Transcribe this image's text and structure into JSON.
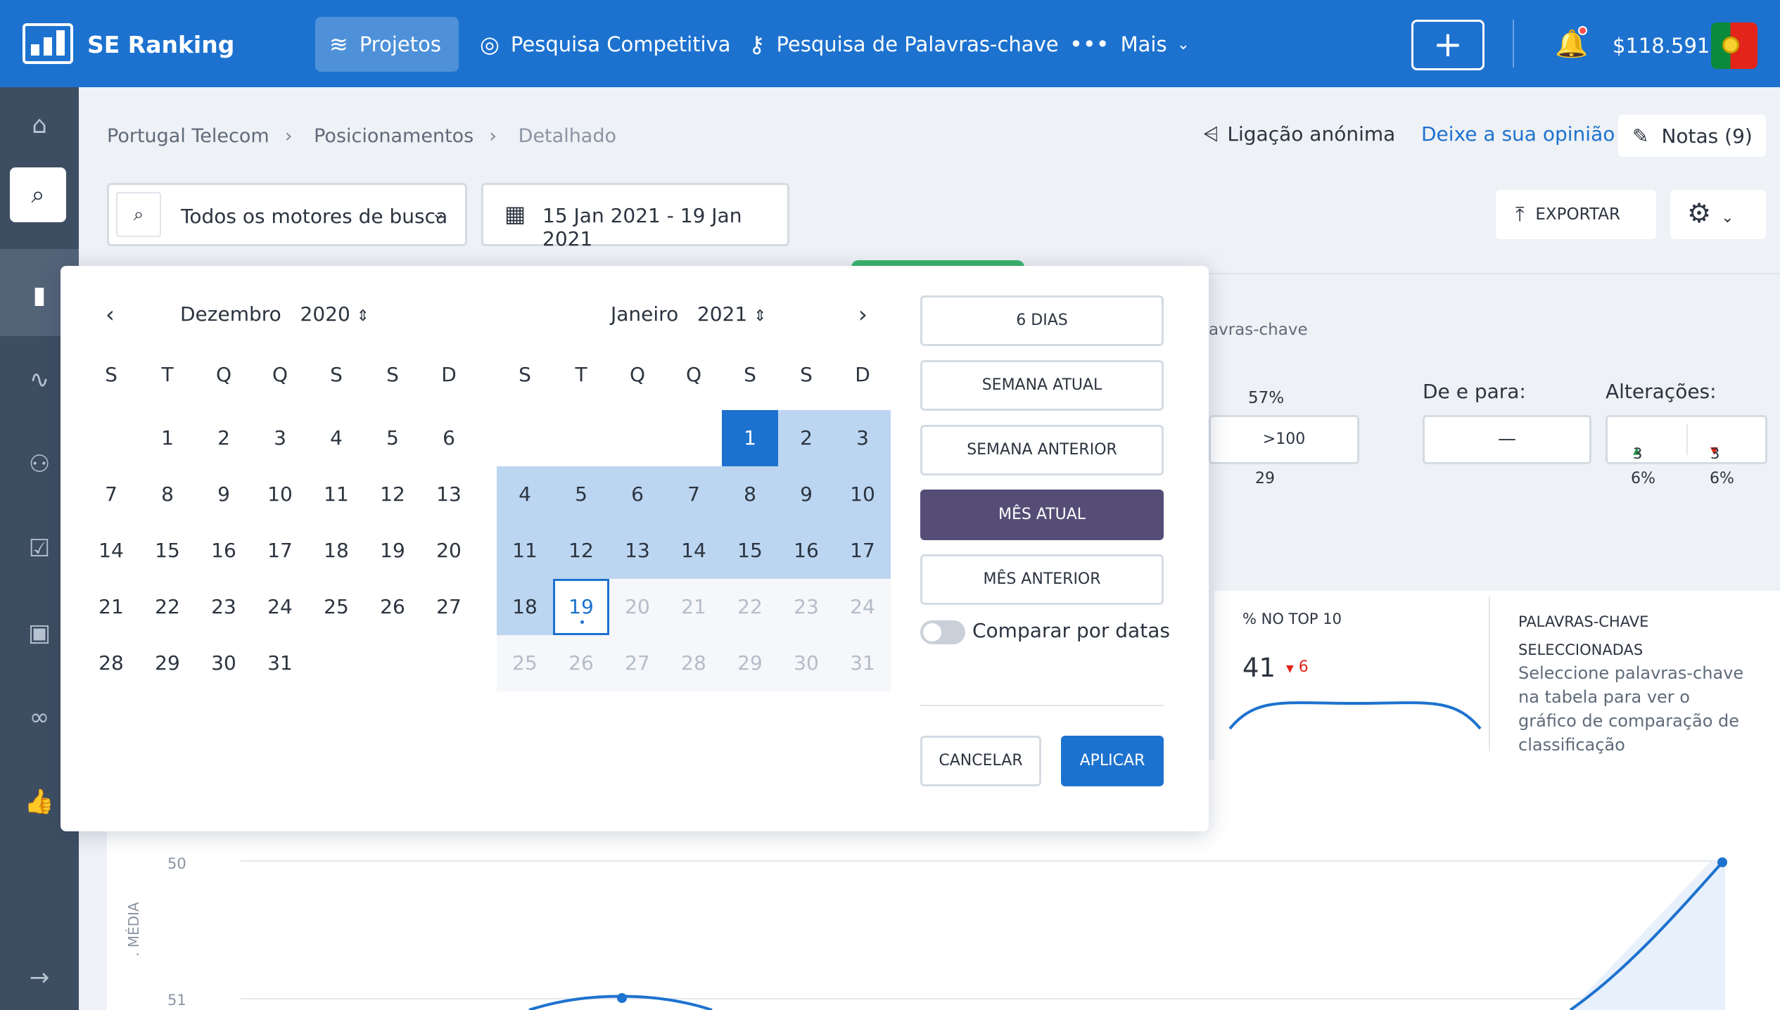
{
  "app": {
    "brand": "SE Ranking",
    "balance": "$118.591"
  },
  "nav": {
    "projects": "Projetos",
    "competitive": "Pesquisa Competitiva",
    "keywords": "Pesquisa de Palavras-chave",
    "more": "Mais"
  },
  "breadcrumb": [
    "Portugal Telecom",
    "Posicionamentos",
    "Detalhado"
  ],
  "header_actions": {
    "share": "Ligação anónima",
    "opinion": "Deixe a sua opinião",
    "notes": "Notas (9)"
  },
  "filters": {
    "engine": "Todos os motores de busca",
    "date_range": "15 Jan 2021 - 19 Jan 2021",
    "export": "EXPORTAR"
  },
  "background": {
    "kw_label": "avras-chave",
    "pct": "57%",
    "pos_box": ">100",
    "pos_count": "29",
    "range_label": "De e para:",
    "range_value": "—",
    "changes_label": "Alterações:",
    "up": "3",
    "down": "3",
    "up_pct": "6%",
    "down_pct": "6%",
    "top10_title": "% no top 10",
    "top10_value": "41",
    "top10_delta": "6",
    "selected_title": "Palavras-chave seleccionadas",
    "selected_desc": "Seleccione palavras-chave na tabela para ver o gráfico de comparação de classificação",
    "chart_ylabel": ". MÉDIA",
    "tick_50": "50",
    "tick_51": "51"
  },
  "calendar": {
    "left": {
      "month": "Dezembro",
      "year": "2020"
    },
    "right": {
      "month": "Janeiro",
      "year": "2021"
    },
    "weekdays": [
      "S",
      "T",
      "Q",
      "Q",
      "S",
      "S",
      "D"
    ]
  },
  "presets": [
    "6 dias",
    "Semana atual",
    "Semana anterior",
    "Mês atual",
    "Mês anterior"
  ],
  "compare_label": "Comparar por datas",
  "buttons": {
    "cancel": "Cancelar",
    "apply": "Aplicar"
  },
  "colors": {
    "primary": "#1d72cf",
    "sidebar": "#3e4e62",
    "active_preset": "#564d77",
    "range": "#bcd6f1"
  }
}
